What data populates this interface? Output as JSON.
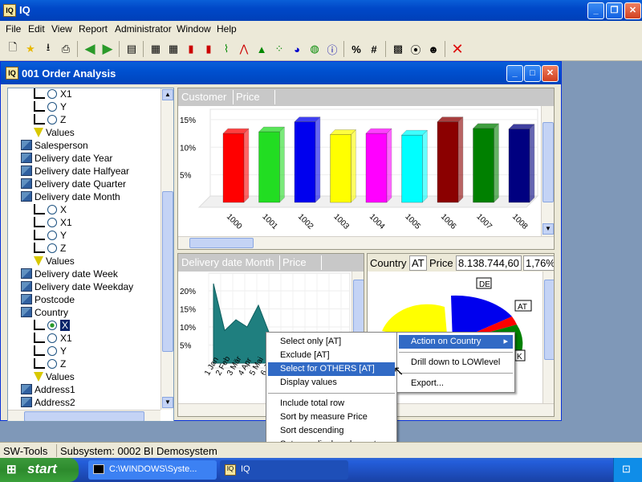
{
  "app": {
    "title": "IQ"
  },
  "menu": [
    "File",
    "Edit",
    "View",
    "Report",
    "Administrator",
    "Window",
    "Help"
  ],
  "window": {
    "title": "001  Order Analysis"
  },
  "tree": [
    {
      "type": "radio",
      "label": "X1"
    },
    {
      "type": "radio",
      "label": "Y"
    },
    {
      "type": "radio",
      "label": "Z"
    },
    {
      "type": "filter",
      "label": "Values"
    },
    {
      "type": "cube",
      "label": "Salesperson"
    },
    {
      "type": "cube",
      "label": "Delivery date Year"
    },
    {
      "type": "cube",
      "label": "Delivery date Halfyear"
    },
    {
      "type": "cube",
      "label": "Delivery date Quarter"
    },
    {
      "type": "cube",
      "label": "Delivery date Month"
    },
    {
      "type": "radio",
      "label": "X"
    },
    {
      "type": "radio",
      "label": "X1"
    },
    {
      "type": "radio",
      "label": "Y"
    },
    {
      "type": "radio",
      "label": "Z"
    },
    {
      "type": "filter",
      "label": "Values"
    },
    {
      "type": "cube",
      "label": "Delivery date Week"
    },
    {
      "type": "cube",
      "label": "Delivery date Weekday"
    },
    {
      "type": "cube",
      "label": "Postcode"
    },
    {
      "type": "cube",
      "label": "Country"
    },
    {
      "type": "radio",
      "label": "X"
    },
    {
      "type": "radio",
      "label": "X1"
    },
    {
      "type": "radio",
      "label": "Y"
    },
    {
      "type": "radio",
      "label": "Z"
    },
    {
      "type": "filter",
      "label": "Values"
    },
    {
      "type": "cube",
      "label": "Address1"
    },
    {
      "type": "cube",
      "label": "Address2"
    }
  ],
  "chart1": {
    "header": [
      "Customer",
      "Price"
    ],
    "yticks": [
      "15%",
      "10%",
      "5%"
    ],
    "categories": [
      "1000",
      "1001",
      "1002",
      "1003",
      "1004",
      "1005",
      "1006",
      "1007",
      "1008"
    ],
    "values": [
      12.5,
      12.8,
      14.6,
      12.3,
      12.5,
      12.2,
      14.6,
      13.4,
      13.3
    ],
    "colors": [
      "#ff0000",
      "#22dd22",
      "#0000ee",
      "#ffff00",
      "#ff00ff",
      "#00ffff",
      "#8b0000",
      "#008000",
      "#000080"
    ]
  },
  "chart2": {
    "header": [
      "Delivery date Month",
      "Price"
    ],
    "yticks": [
      "20%",
      "15%",
      "10%",
      "5%"
    ],
    "xlabels": [
      "1 Jan",
      "2 Feb",
      "3 Mär",
      "4 Apr",
      "5 Mai",
      "6 Jun"
    ],
    "values": [
      22,
      9,
      12,
      10,
      16,
      8
    ]
  },
  "chart3": {
    "header": {
      "dim": "Country",
      "sel": "AT",
      "measure": "Price",
      "value": "8.138.744,60",
      "pct": "1,76%"
    },
    "slices": [
      "DE",
      "AT",
      "K"
    ]
  },
  "context_menu": {
    "items": [
      "Select only [AT]",
      "Exclude [AT]",
      "Select for OTHERS [AT]",
      "Display values",
      "Include total row",
      "Sort by measure Price",
      "Sort descending",
      "Set max display elements"
    ]
  },
  "submenu": {
    "items": [
      "Action on Country",
      "Drill down to LOWlevel",
      "Export..."
    ]
  },
  "status": {
    "left": "SW-Tools",
    "right": "Subsystem: 0002 BI Demosystem"
  },
  "taskbar": {
    "start": "start",
    "tasks": [
      "C:\\WINDOWS\\Syste...",
      "IQ"
    ]
  }
}
